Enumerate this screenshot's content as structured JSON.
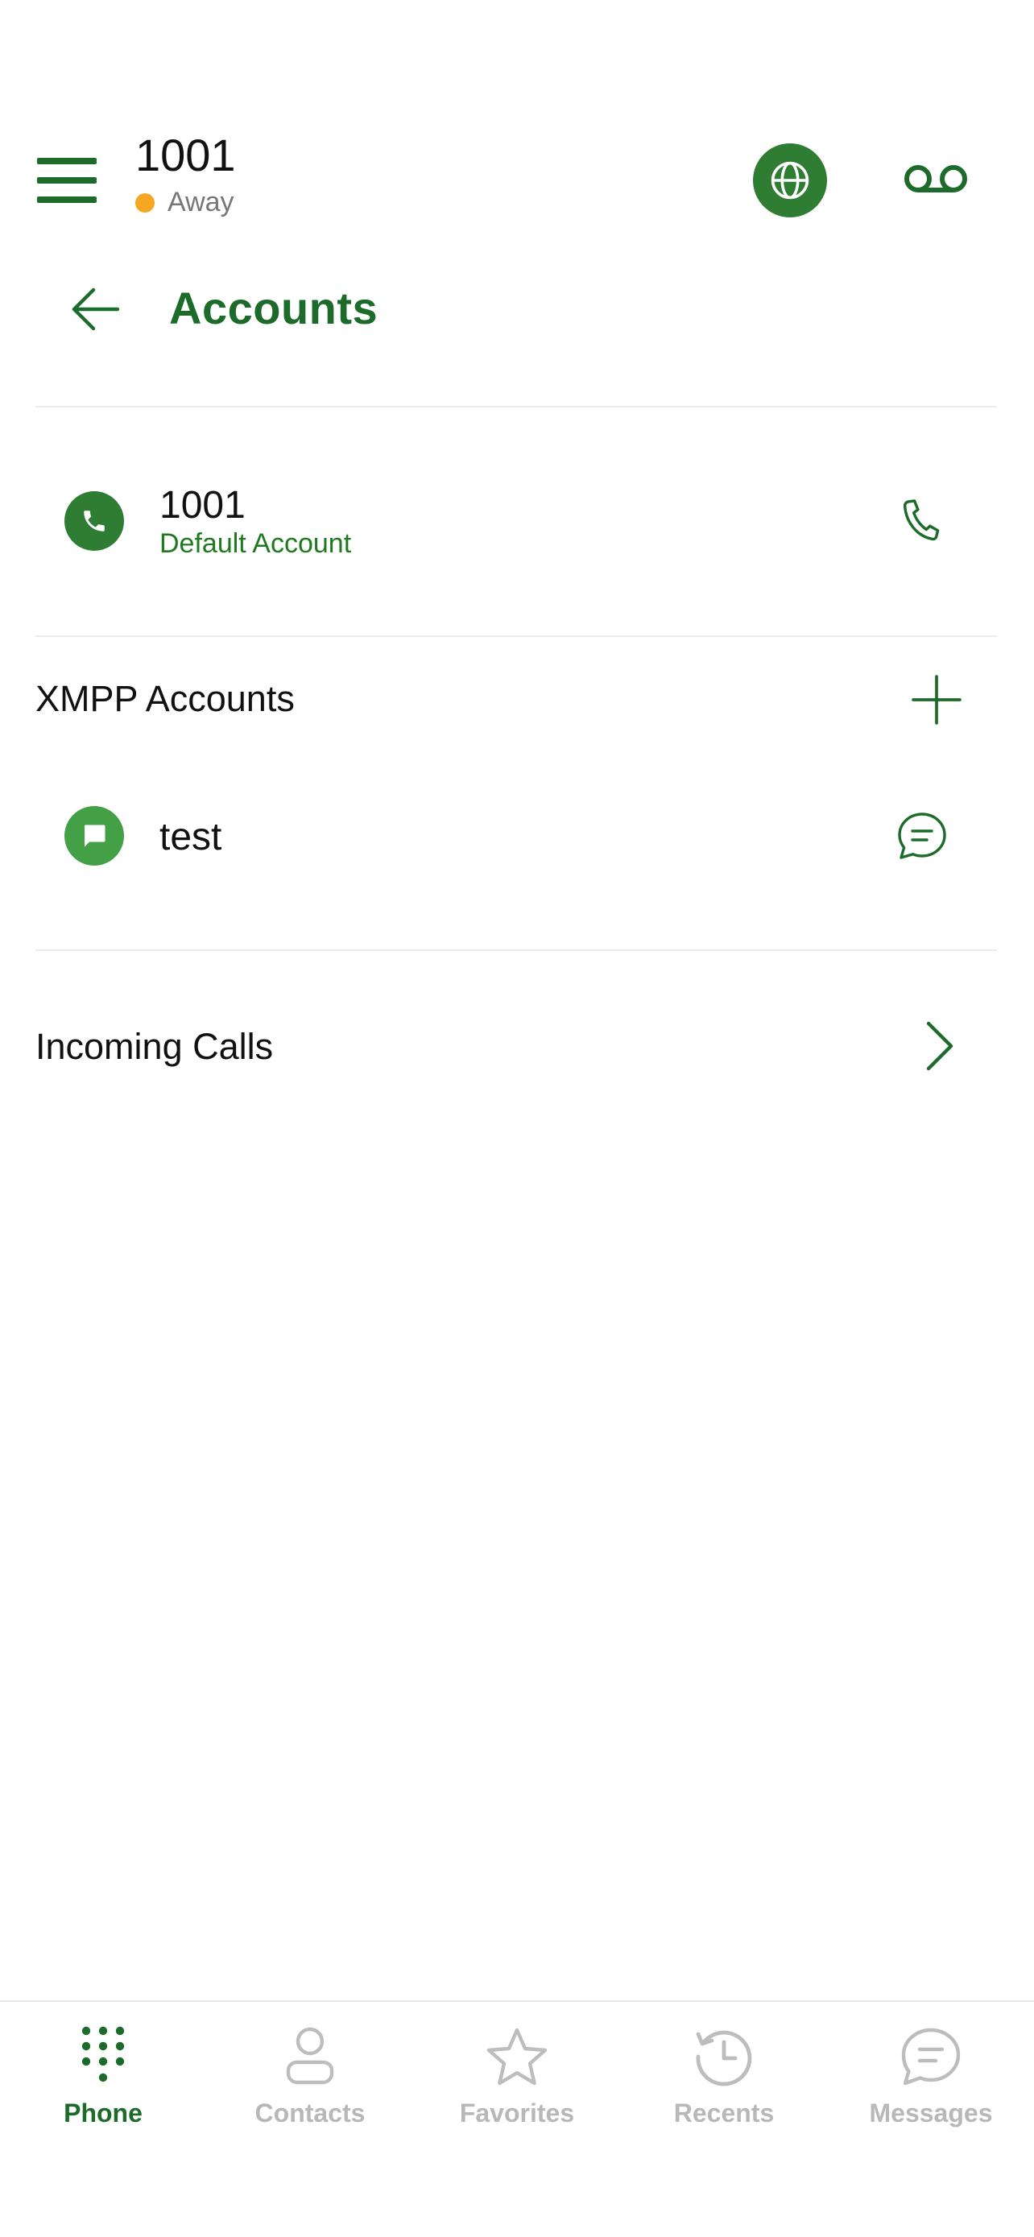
{
  "header": {
    "account_name": "1001",
    "status_text": "Away",
    "status_color": "#f5a623"
  },
  "page": {
    "title": "Accounts"
  },
  "sip_account": {
    "name": "1001",
    "subtitle": "Default Account"
  },
  "xmpp": {
    "section_title": "XMPP Accounts",
    "accounts": [
      {
        "name": "test"
      }
    ]
  },
  "incoming_calls": {
    "label": "Incoming Calls"
  },
  "bottom_nav": {
    "items": [
      {
        "label": "Phone",
        "icon": "dialpad-icon",
        "active": true
      },
      {
        "label": "Contacts",
        "icon": "person-icon",
        "active": false
      },
      {
        "label": "Favorites",
        "icon": "star-icon",
        "active": false
      },
      {
        "label": "Recents",
        "icon": "history-icon",
        "active": false
      },
      {
        "label": "Messages",
        "icon": "chat-icon",
        "active": false
      }
    ]
  },
  "colors": {
    "brand_green": "#1d6b2a",
    "accent_green": "#2e7d32",
    "inactive_gray": "#b8b8b8"
  }
}
